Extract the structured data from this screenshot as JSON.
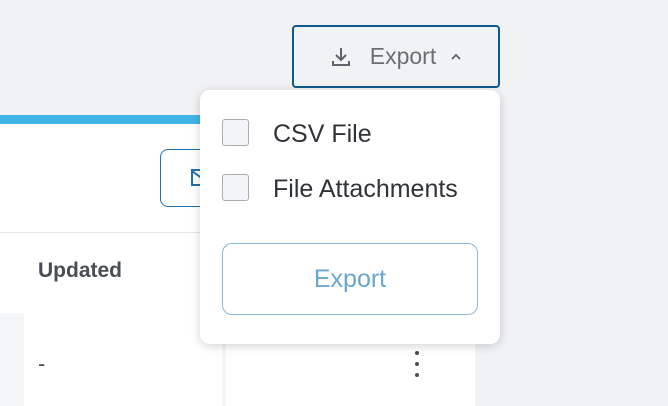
{
  "toolbar": {
    "export_label": "Export",
    "export_icon": "download-icon",
    "chevron_icon": "chevron-up-icon"
  },
  "table": {
    "header_updated": "Updated",
    "row_updated_value": "-"
  },
  "export_menu": {
    "options": [
      {
        "label": "CSV File",
        "checked": false
      },
      {
        "label": "File Attachments",
        "checked": false
      }
    ],
    "submit_label": "Export"
  },
  "colors": {
    "accent": "#40b4e5",
    "primary_border": "#0d5a91",
    "export_text": "#6aa6cf"
  }
}
